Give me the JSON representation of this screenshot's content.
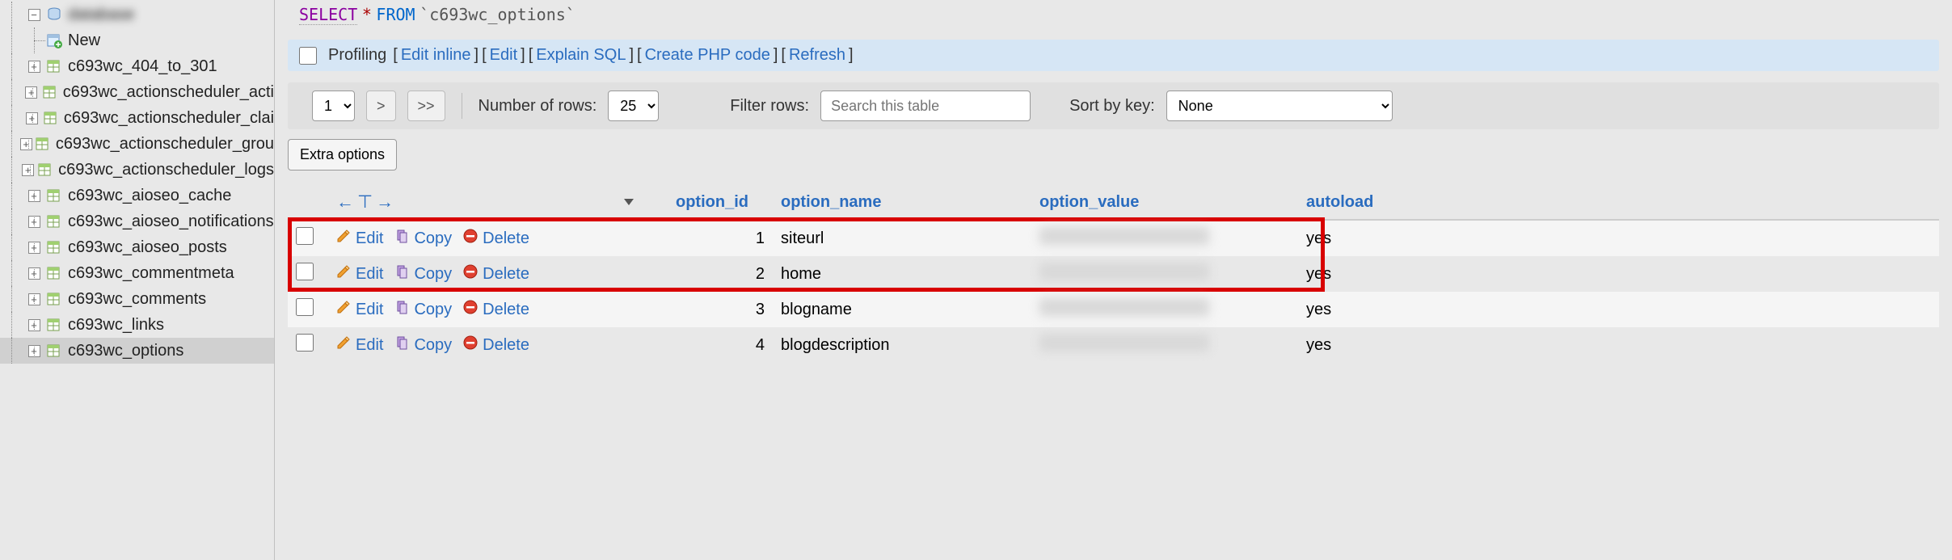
{
  "sidebar": {
    "root_label": "database",
    "new_label": "New",
    "tables": [
      "c693wc_404_to_301",
      "c693wc_actionscheduler_acti",
      "c693wc_actionscheduler_clai",
      "c693wc_actionscheduler_grou",
      "c693wc_actionscheduler_logs",
      "c693wc_aioseo_cache",
      "c693wc_aioseo_notifications",
      "c693wc_aioseo_posts",
      "c693wc_commentmeta",
      "c693wc_comments",
      "c693wc_links",
      "c693wc_options"
    ],
    "selected_index": 11
  },
  "sql": {
    "select": "SELECT",
    "star": "*",
    "from": "FROM",
    "table": "`c693wc_options`"
  },
  "profiling_bar": {
    "profiling": "Profiling",
    "edit_inline": "Edit inline",
    "edit": "Edit",
    "explain": "Explain SQL",
    "create_php": "Create PHP code",
    "refresh": "Refresh"
  },
  "controls": {
    "page_value": "1",
    "next": ">",
    "last": ">>",
    "num_rows_label": "Number of rows:",
    "num_rows_value": "25",
    "filter_label": "Filter rows:",
    "filter_placeholder": "Search this table",
    "sort_label": "Sort by key:",
    "sort_value": "None"
  },
  "extra_options": "Extra options",
  "columns": {
    "option_id": "option_id",
    "option_name": "option_name",
    "option_value": "option_value",
    "autoload": "autoload"
  },
  "actions": {
    "edit": "Edit",
    "copy": "Copy",
    "delete": "Delete"
  },
  "rows": [
    {
      "option_id": "1",
      "option_name": "siteurl",
      "autoload": "yes"
    },
    {
      "option_id": "2",
      "option_name": "home",
      "autoload": "yes"
    },
    {
      "option_id": "3",
      "option_name": "blogname",
      "autoload": "yes"
    },
    {
      "option_id": "4",
      "option_name": "blogdescription",
      "autoload": "yes"
    }
  ]
}
